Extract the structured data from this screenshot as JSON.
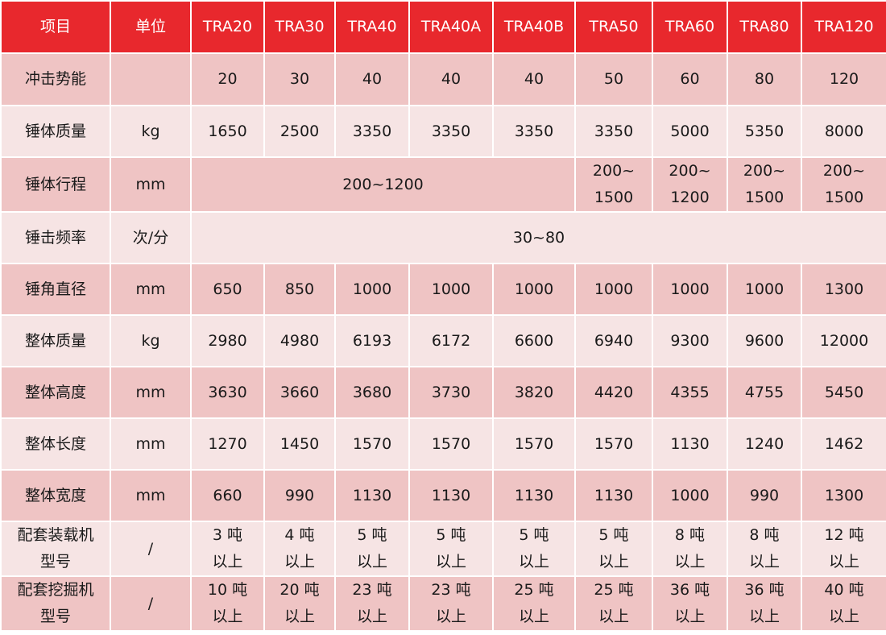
{
  "header": {
    "item": "项目",
    "unit": "单位",
    "models": [
      "TRA20",
      "TRA30",
      "TRA40",
      "TRA40A",
      "TRA40B",
      "TRA50",
      "TRA60",
      "TRA80",
      "TRA120"
    ]
  },
  "rows": {
    "impact_energy": {
      "label": "冲击势能",
      "unit": "",
      "values": [
        "20",
        "30",
        "40",
        "40",
        "40",
        "50",
        "60",
        "80",
        "120"
      ]
    },
    "hammer_mass": {
      "label": "锤体质量",
      "unit": "kg",
      "values": [
        "1650",
        "2500",
        "3350",
        "3350",
        "3350",
        "3350",
        "5000",
        "5350",
        "8000"
      ]
    },
    "hammer_stroke": {
      "label": "锤体行程",
      "unit": "mm",
      "merged": "200~1200",
      "values": [
        [
          "200~",
          "1500"
        ],
        [
          "200~",
          "1200"
        ],
        [
          "200~",
          "1500"
        ],
        [
          "200~",
          "1500"
        ]
      ]
    },
    "strike_frequency": {
      "label": "锤击频率",
      "unit": "次/分",
      "merged": "30~80"
    },
    "hammer_diameter": {
      "label": "锤角直径",
      "unit": "mm",
      "values": [
        "650",
        "850",
        "1000",
        "1000",
        "1000",
        "1000",
        "1000",
        "1000",
        "1300"
      ]
    },
    "total_mass": {
      "label": "整体质量",
      "unit": "kg",
      "values": [
        "2980",
        "4980",
        "6193",
        "6172",
        "6600",
        "6940",
        "9300",
        "9600",
        "12000"
      ]
    },
    "total_height": {
      "label": "整体高度",
      "unit": "mm",
      "values": [
        "3630",
        "3660",
        "3680",
        "3730",
        "3820",
        "4420",
        "4355",
        "4755",
        "5450"
      ]
    },
    "total_length": {
      "label": "整体长度",
      "unit": "mm",
      "values": [
        "1270",
        "1450",
        "1570",
        "1570",
        "1570",
        "1570",
        "1130",
        "1240",
        "1462"
      ]
    },
    "total_width": {
      "label": "整体宽度",
      "unit": "mm",
      "values": [
        "660",
        "990",
        "1130",
        "1130",
        "1130",
        "1130",
        "1000",
        "990",
        "1300"
      ]
    },
    "loader_model": {
      "label": [
        "配套装载机",
        "型号"
      ],
      "unit": "/",
      "values": [
        [
          "3 吨",
          "以上"
        ],
        [
          "4 吨",
          "以上"
        ],
        [
          "5 吨",
          "以上"
        ],
        [
          "5 吨",
          "以上"
        ],
        [
          "5 吨",
          "以上"
        ],
        [
          "5 吨",
          "以上"
        ],
        [
          "8 吨",
          "以上"
        ],
        [
          "8 吨",
          "以上"
        ],
        [
          "12 吨",
          "以上"
        ]
      ]
    },
    "excavator_model": {
      "label": [
        "配套挖掘机",
        "型号"
      ],
      "unit": "/",
      "values": [
        [
          "10 吨",
          "以上"
        ],
        [
          "20 吨",
          "以上"
        ],
        [
          "23 吨",
          "以上"
        ],
        [
          "23 吨",
          "以上"
        ],
        [
          "25 吨",
          "以上"
        ],
        [
          "25 吨",
          "以上"
        ],
        [
          "36 吨",
          "以上"
        ],
        [
          "36 吨",
          "以上"
        ],
        [
          "40 吨",
          "以上"
        ]
      ]
    }
  },
  "colors": {
    "header_bg": "#e8282d",
    "row_dark": "#efc4c4",
    "row_light": "#f6e4e4"
  }
}
